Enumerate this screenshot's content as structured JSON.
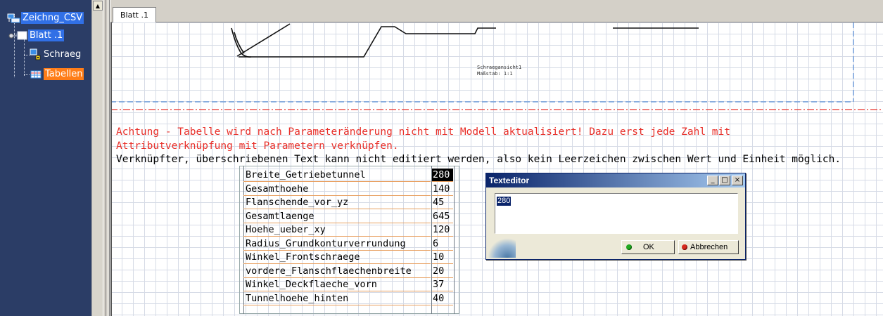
{
  "tree": {
    "items": [
      {
        "label": "Zeichng_CSV",
        "state": "selected-blue"
      },
      {
        "label": "Blatt .1",
        "state": "selected-blue"
      },
      {
        "label": "Schraeg",
        "state": "plain"
      },
      {
        "label": "Tabellen",
        "state": "selected-orange"
      }
    ]
  },
  "tab": {
    "label": "Blatt .1"
  },
  "view_caption": {
    "line1": "Schraegansicht1",
    "line2": "Maßstab:  1:1"
  },
  "annotations": {
    "warning_line1": "Achtung - Tabelle wird nach Parameteränderung nicht mit Modell aktualisiert! Dazu erst jede Zahl mit",
    "warning_line2": "Attributverknüpfung mit Parametern verknüpfen.",
    "note_line": "Verknüpfter, überschriebenen Text kann nicht editiert werden,  also kein Leerzeichen zwischen Wert und Einheit möglich."
  },
  "parameters": [
    {
      "name": "Breite_Getriebetunnel",
      "value": "280"
    },
    {
      "name": "Gesamthoehe",
      "value": "140"
    },
    {
      "name": "Flanschende_vor_yz",
      "value": "45"
    },
    {
      "name": "Gesamtlaenge",
      "value": "645"
    },
    {
      "name": "Hoehe_ueber_xy",
      "value": "120"
    },
    {
      "name": "Radius_Grundkonturverrundung",
      "value": "6"
    },
    {
      "name": "Winkel_Frontschraege",
      "value": "10"
    },
    {
      "name": "vordere_Flanschflaechenbreite",
      "value": "20"
    },
    {
      "name": "Winkel_Deckflaeche_vorn",
      "value": "37"
    },
    {
      "name": "Tunnelhoehe_hinten",
      "value": "40"
    }
  ],
  "text_editor": {
    "title": "Texteditor",
    "value": "280",
    "ok_label": "OK",
    "cancel_label": "Abbrechen",
    "minimize_glyph": "_",
    "maximize_glyph": "□",
    "close_glyph": "×"
  },
  "colors": {
    "tree_background": "#2b3d66",
    "selection_blue": "#3170e6",
    "selection_orange": "#ff7d18",
    "warning_red": "#e8302a",
    "title_bar": "#0a246a"
  }
}
